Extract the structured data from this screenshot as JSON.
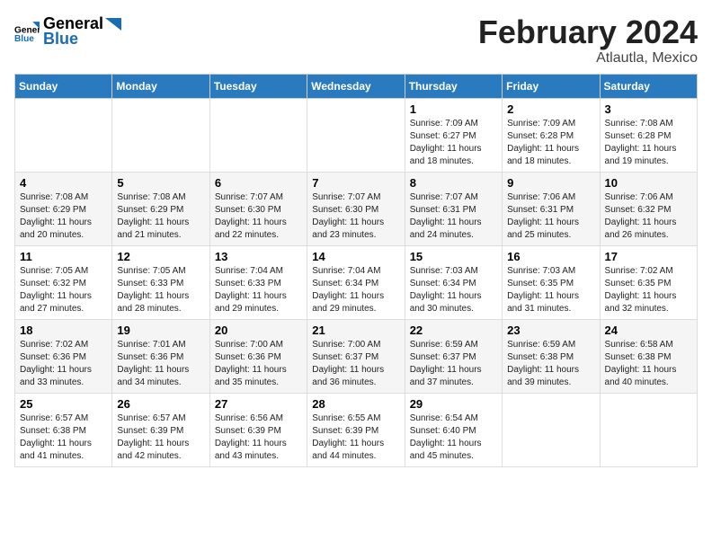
{
  "logo": {
    "text_general": "General",
    "text_blue": "Blue"
  },
  "title": "February 2024",
  "subtitle": "Atlautla, Mexico",
  "days_of_week": [
    "Sunday",
    "Monday",
    "Tuesday",
    "Wednesday",
    "Thursday",
    "Friday",
    "Saturday"
  ],
  "weeks": [
    [
      {
        "day": "",
        "info": ""
      },
      {
        "day": "",
        "info": ""
      },
      {
        "day": "",
        "info": ""
      },
      {
        "day": "",
        "info": ""
      },
      {
        "day": "1",
        "info": "Sunrise: 7:09 AM\nSunset: 6:27 PM\nDaylight: 11 hours\nand 18 minutes."
      },
      {
        "day": "2",
        "info": "Sunrise: 7:09 AM\nSunset: 6:28 PM\nDaylight: 11 hours\nand 18 minutes."
      },
      {
        "day": "3",
        "info": "Sunrise: 7:08 AM\nSunset: 6:28 PM\nDaylight: 11 hours\nand 19 minutes."
      }
    ],
    [
      {
        "day": "4",
        "info": "Sunrise: 7:08 AM\nSunset: 6:29 PM\nDaylight: 11 hours\nand 20 minutes."
      },
      {
        "day": "5",
        "info": "Sunrise: 7:08 AM\nSunset: 6:29 PM\nDaylight: 11 hours\nand 21 minutes."
      },
      {
        "day": "6",
        "info": "Sunrise: 7:07 AM\nSunset: 6:30 PM\nDaylight: 11 hours\nand 22 minutes."
      },
      {
        "day": "7",
        "info": "Sunrise: 7:07 AM\nSunset: 6:30 PM\nDaylight: 11 hours\nand 23 minutes."
      },
      {
        "day": "8",
        "info": "Sunrise: 7:07 AM\nSunset: 6:31 PM\nDaylight: 11 hours\nand 24 minutes."
      },
      {
        "day": "9",
        "info": "Sunrise: 7:06 AM\nSunset: 6:31 PM\nDaylight: 11 hours\nand 25 minutes."
      },
      {
        "day": "10",
        "info": "Sunrise: 7:06 AM\nSunset: 6:32 PM\nDaylight: 11 hours\nand 26 minutes."
      }
    ],
    [
      {
        "day": "11",
        "info": "Sunrise: 7:05 AM\nSunset: 6:32 PM\nDaylight: 11 hours\nand 27 minutes."
      },
      {
        "day": "12",
        "info": "Sunrise: 7:05 AM\nSunset: 6:33 PM\nDaylight: 11 hours\nand 28 minutes."
      },
      {
        "day": "13",
        "info": "Sunrise: 7:04 AM\nSunset: 6:33 PM\nDaylight: 11 hours\nand 29 minutes."
      },
      {
        "day": "14",
        "info": "Sunrise: 7:04 AM\nSunset: 6:34 PM\nDaylight: 11 hours\nand 29 minutes."
      },
      {
        "day": "15",
        "info": "Sunrise: 7:03 AM\nSunset: 6:34 PM\nDaylight: 11 hours\nand 30 minutes."
      },
      {
        "day": "16",
        "info": "Sunrise: 7:03 AM\nSunset: 6:35 PM\nDaylight: 11 hours\nand 31 minutes."
      },
      {
        "day": "17",
        "info": "Sunrise: 7:02 AM\nSunset: 6:35 PM\nDaylight: 11 hours\nand 32 minutes."
      }
    ],
    [
      {
        "day": "18",
        "info": "Sunrise: 7:02 AM\nSunset: 6:36 PM\nDaylight: 11 hours\nand 33 minutes."
      },
      {
        "day": "19",
        "info": "Sunrise: 7:01 AM\nSunset: 6:36 PM\nDaylight: 11 hours\nand 34 minutes."
      },
      {
        "day": "20",
        "info": "Sunrise: 7:00 AM\nSunset: 6:36 PM\nDaylight: 11 hours\nand 35 minutes."
      },
      {
        "day": "21",
        "info": "Sunrise: 7:00 AM\nSunset: 6:37 PM\nDaylight: 11 hours\nand 36 minutes."
      },
      {
        "day": "22",
        "info": "Sunrise: 6:59 AM\nSunset: 6:37 PM\nDaylight: 11 hours\nand 37 minutes."
      },
      {
        "day": "23",
        "info": "Sunrise: 6:59 AM\nSunset: 6:38 PM\nDaylight: 11 hours\nand 39 minutes."
      },
      {
        "day": "24",
        "info": "Sunrise: 6:58 AM\nSunset: 6:38 PM\nDaylight: 11 hours\nand 40 minutes."
      }
    ],
    [
      {
        "day": "25",
        "info": "Sunrise: 6:57 AM\nSunset: 6:38 PM\nDaylight: 11 hours\nand 41 minutes."
      },
      {
        "day": "26",
        "info": "Sunrise: 6:57 AM\nSunset: 6:39 PM\nDaylight: 11 hours\nand 42 minutes."
      },
      {
        "day": "27",
        "info": "Sunrise: 6:56 AM\nSunset: 6:39 PM\nDaylight: 11 hours\nand 43 minutes."
      },
      {
        "day": "28",
        "info": "Sunrise: 6:55 AM\nSunset: 6:39 PM\nDaylight: 11 hours\nand 44 minutes."
      },
      {
        "day": "29",
        "info": "Sunrise: 6:54 AM\nSunset: 6:40 PM\nDaylight: 11 hours\nand 45 minutes."
      },
      {
        "day": "",
        "info": ""
      },
      {
        "day": "",
        "info": ""
      }
    ]
  ]
}
